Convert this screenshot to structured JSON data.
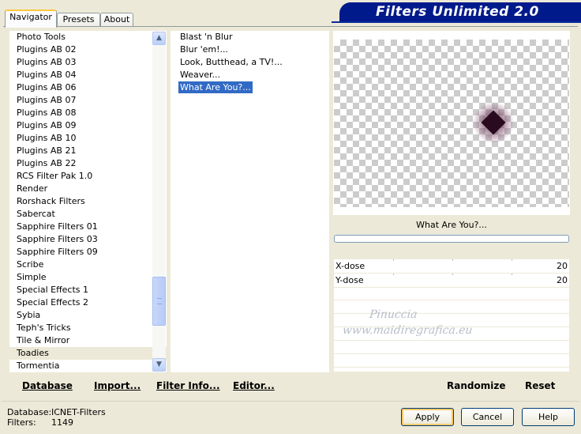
{
  "tabs": [
    "Navigator",
    "Presets",
    "About"
  ],
  "title": "Filters Unlimited 2.0",
  "categories": [
    "Photo Tools",
    "Plugins AB 02",
    "Plugins AB 03",
    "Plugins AB 04",
    "Plugins AB 06",
    "Plugins AB 07",
    "Plugins AB 08",
    "Plugins AB 09",
    "Plugins AB 10",
    "Plugins AB 21",
    "Plugins AB 22",
    "RCS Filter Pak 1.0",
    "Render",
    "Rorshack Filters",
    "Sabercat",
    "Sapphire Filters 01",
    "Sapphire Filters 03",
    "Sapphire Filters 09",
    "Scribe",
    "Simple",
    "Special Effects 1",
    "Special Effects 2",
    "Sybia",
    "Teph's Tricks",
    "Tile & Mirror",
    "Toadies",
    "Tormentia"
  ],
  "selected_category": "Toadies",
  "filters": [
    "Blast 'n Blur",
    "Blur 'em!...",
    "Look, Butthead, a TV!...",
    "Weaver...",
    "What Are You?..."
  ],
  "selected_filter": "What Are You?...",
  "preview_filter_name": "What Are You?...",
  "params": [
    {
      "label": "X-dose",
      "value": "20"
    },
    {
      "label": "Y-dose",
      "value": "20"
    }
  ],
  "watermark": [
    "Pinuccia",
    "www.maidiregrafica.eu"
  ],
  "toolbar": {
    "database_label": "Database",
    "import_label": "Import...",
    "filter_info_label": "Filter Info...",
    "editor_label": "Editor...",
    "randomize_label": "Randomize",
    "reset_label": "Reset"
  },
  "status": {
    "database_key": "Database:",
    "database_value": "ICNET-Filters",
    "filters_key": "Filters:",
    "filters_value": "1149"
  },
  "buttons": {
    "apply": "Apply",
    "cancel": "Cancel",
    "help": "Help"
  },
  "icons": {
    "scroll_up": "chevron-up-icon",
    "scroll_down": "chevron-down-icon"
  }
}
